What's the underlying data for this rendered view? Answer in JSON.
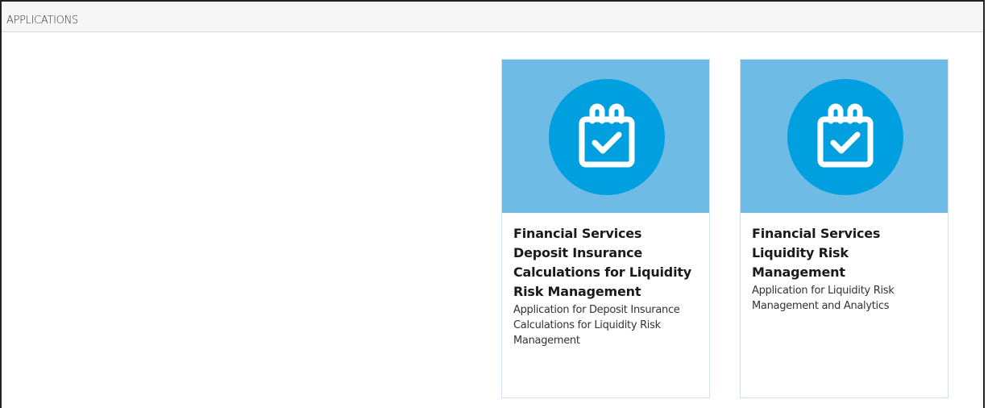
{
  "header": {
    "title": "APPLICATIONS"
  },
  "applications": [
    {
      "title": "Financial Services Deposit Insurance Calculations for Liquidity Risk Management",
      "description": "Application for Deposit Insurance Calculations for Liquidity Risk Management",
      "icon": "calendar-check-icon"
    },
    {
      "title": "Financial Services Liquidity Risk Management",
      "description": "Application for Liquidity Risk Management and Analytics",
      "icon": "calendar-check-icon"
    }
  ],
  "colors": {
    "banner": "#6ebbe6",
    "icon_circle": "#009fe0",
    "icon_glyph": "#ffffff"
  }
}
